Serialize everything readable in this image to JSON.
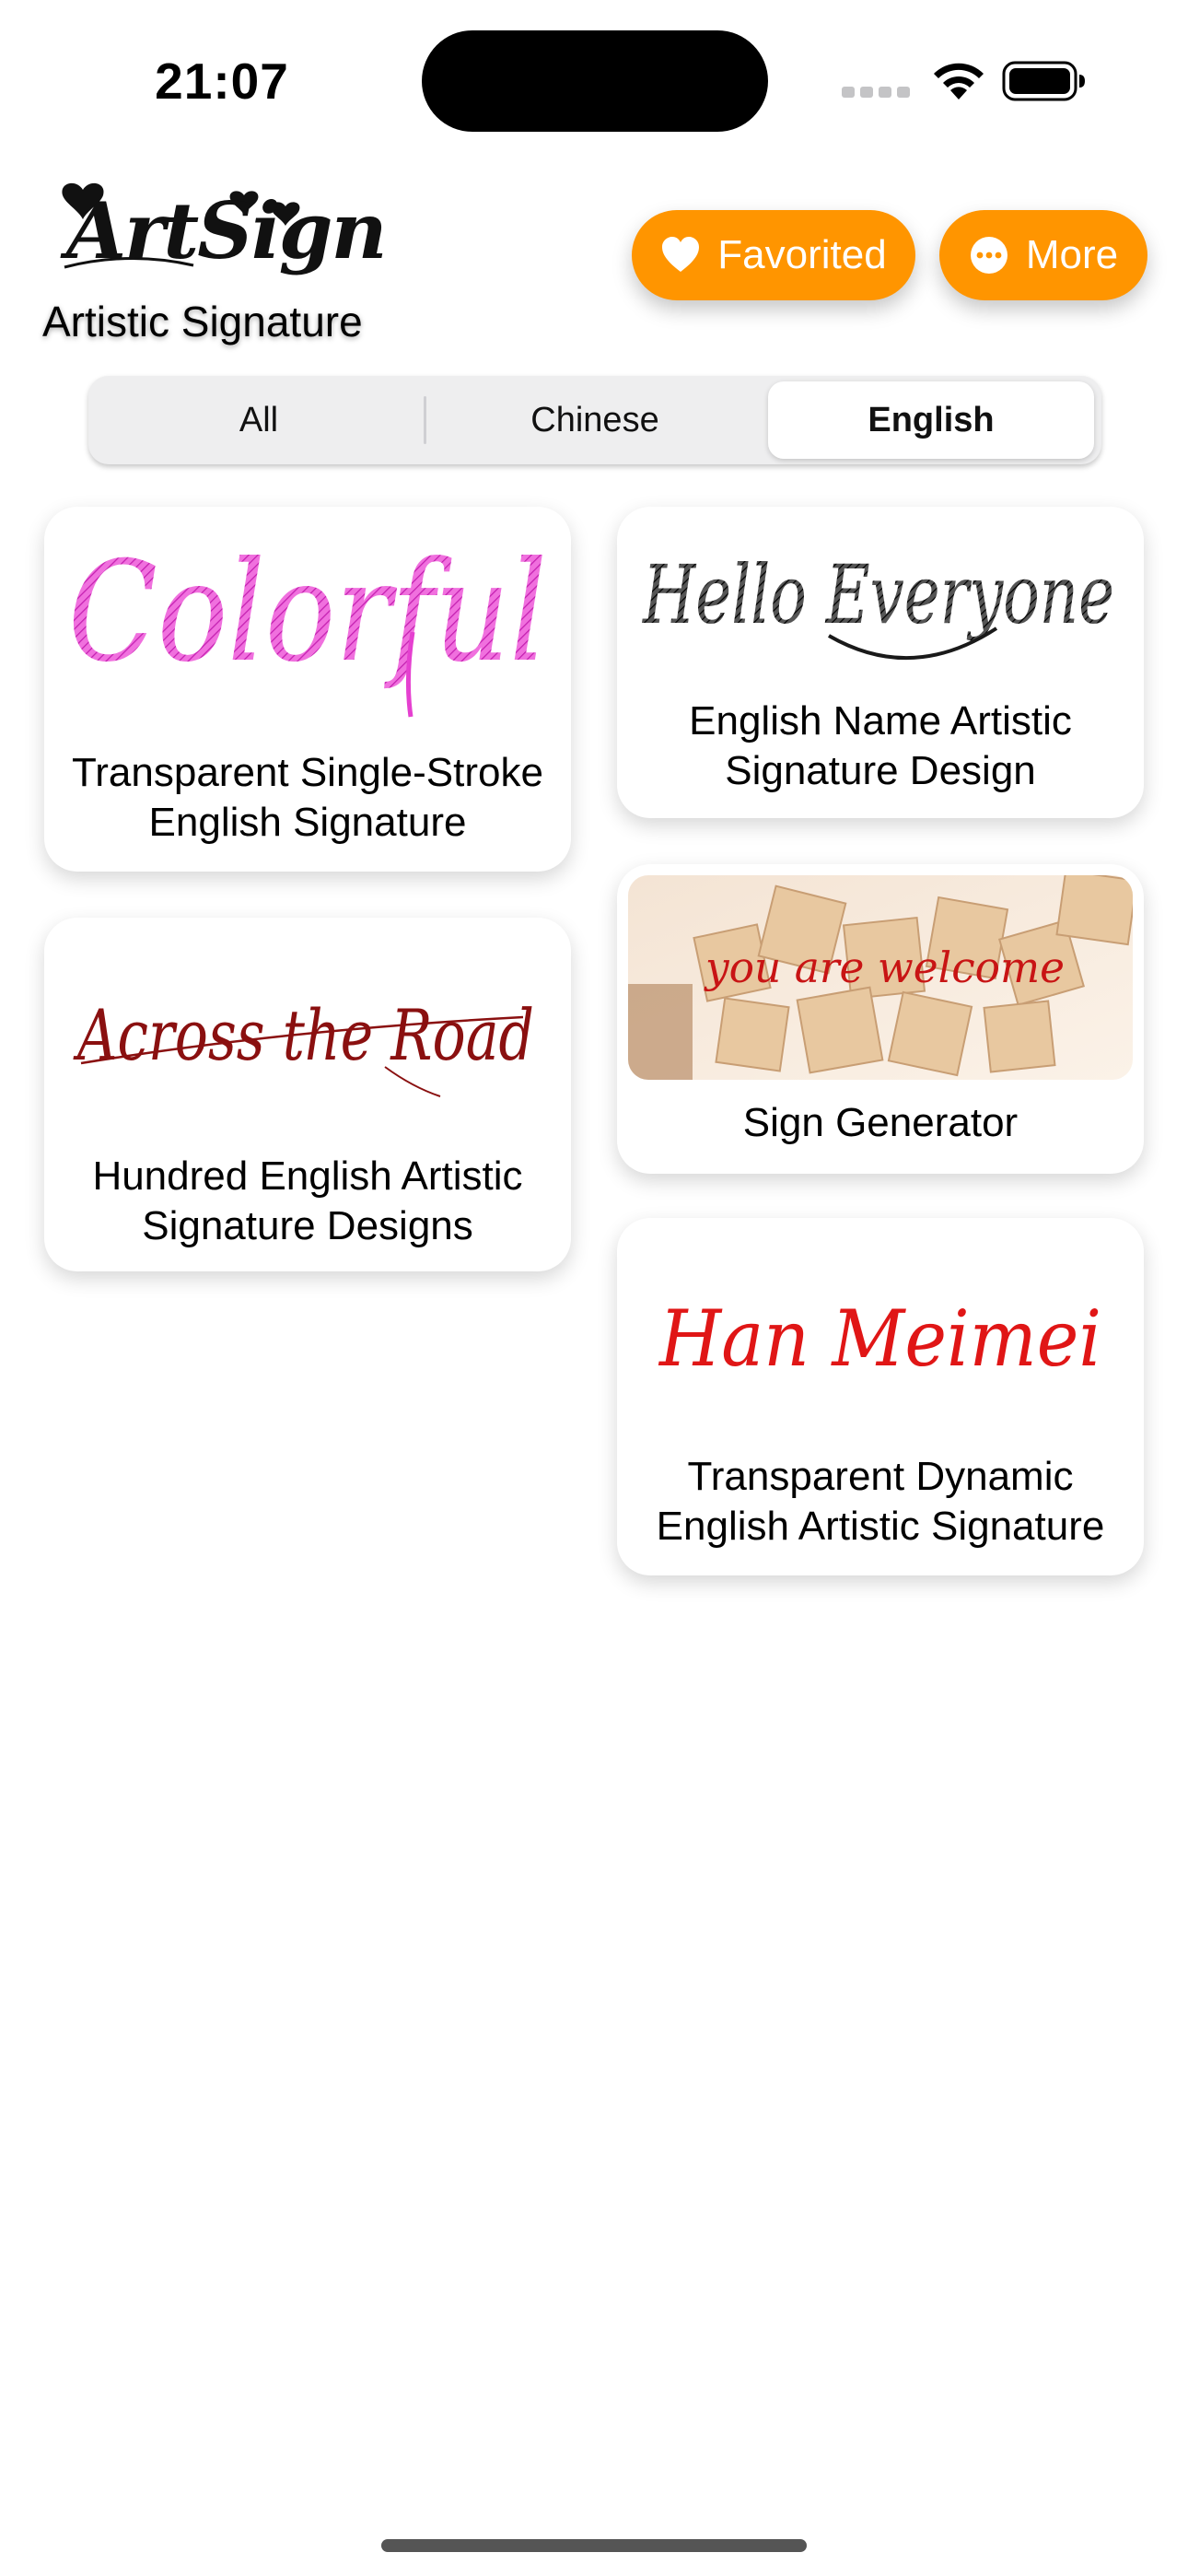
{
  "status_bar": {
    "time": "21:07",
    "icons": [
      "cellular-signal-icon",
      "wifi-icon",
      "battery-icon"
    ]
  },
  "header": {
    "logo_text": "ArtSign",
    "subtitle": "Artistic Signature",
    "favorited_label": "Favorited",
    "more_label": "More"
  },
  "tabs": {
    "items": [
      {
        "label": "All",
        "selected": false
      },
      {
        "label": "Chinese",
        "selected": false
      },
      {
        "label": "English",
        "selected": true
      }
    ]
  },
  "cards": [
    {
      "title": "Transparent Single-Stroke English Signature",
      "sample": "Colorful",
      "sample_color": "#e540d0"
    },
    {
      "title": "English Name Artistic Signature Design",
      "sample": "Hello Everyone",
      "sample_color": "#1a1a1a"
    },
    {
      "title": "Hundred English Artistic Signature Designs",
      "sample": "Across the Road",
      "sample_color": "#8a1010"
    },
    {
      "title": "Sign Generator",
      "sample": "you are welcome",
      "sample_color": "#c81414"
    },
    {
      "title": "Transparent Dynamic English Artistic Signature",
      "sample": "Han Meimei",
      "sample_color": "#e01616"
    }
  ],
  "colors": {
    "accent": "#ff9500",
    "segment_background": "#eeeeef",
    "card_background": "#ffffff"
  }
}
